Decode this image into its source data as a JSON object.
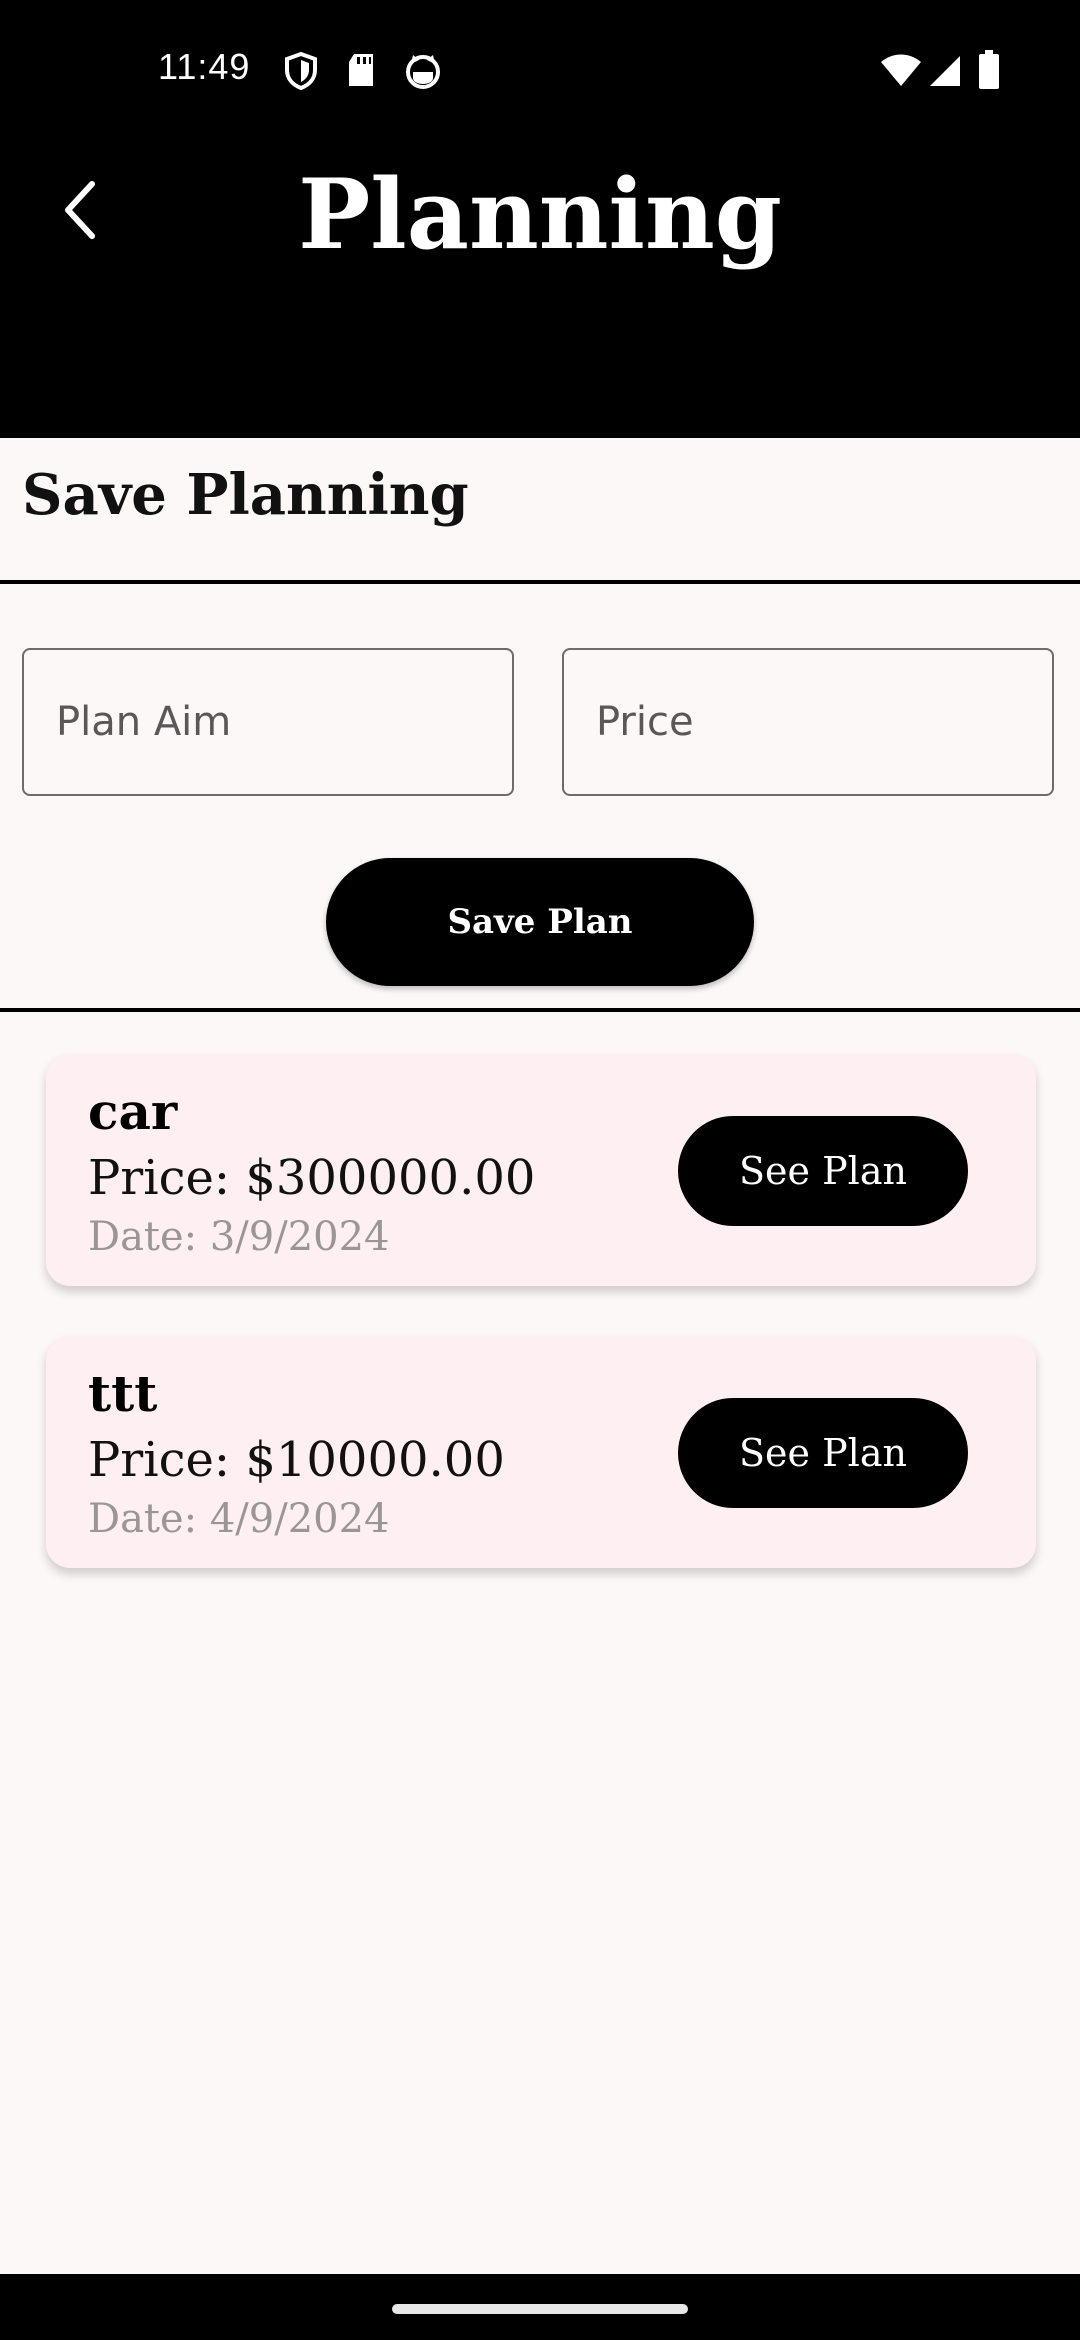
{
  "status_bar": {
    "time": "11:49",
    "icons": [
      "shield-icon",
      "sd-card-icon",
      "cat-face-icon",
      "wifi-icon",
      "cell-signal-icon",
      "battery-icon"
    ]
  },
  "header": {
    "title": "Planning",
    "back_icon": "chevron-left-icon"
  },
  "form": {
    "section_title": "Save Planning",
    "plan_aim": {
      "placeholder": "Plan Aim",
      "value": ""
    },
    "price": {
      "placeholder": "Price",
      "value": ""
    },
    "save_label": "Save Plan"
  },
  "plans": [
    {
      "name": "car",
      "price": "Price: $300000.00",
      "date": "Date: 3/9/2024",
      "button_label": "See Plan"
    },
    {
      "name": "ttt",
      "price": "Price: $10000.00",
      "date": "Date: 4/9/2024",
      "button_label": "See Plan"
    }
  ],
  "colors": {
    "header_bg": "#000000",
    "page_bg": "#fdf8f8",
    "card_bg": "#fdeff2",
    "button_bg": "#000000",
    "date_text": "#9a9697"
  }
}
